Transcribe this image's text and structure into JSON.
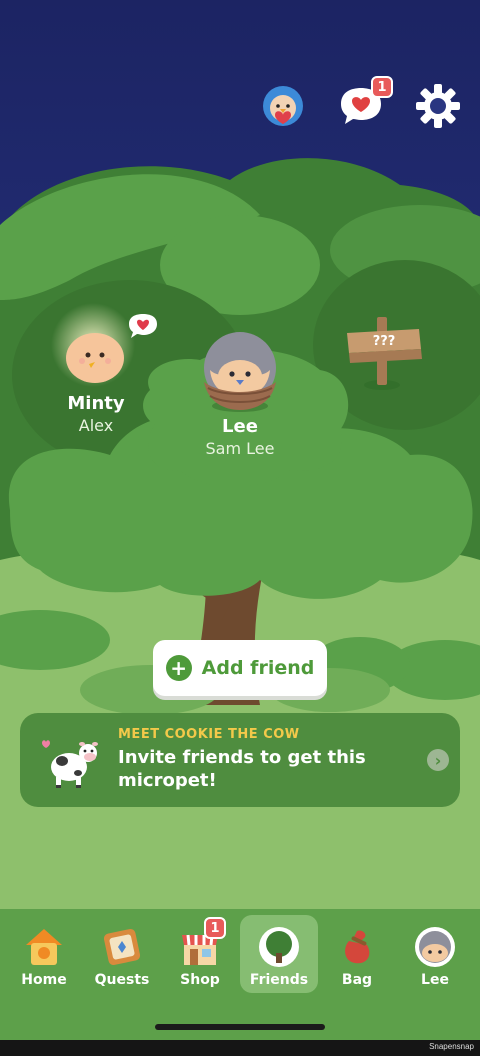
{
  "colors": {
    "sky_top": "#1d2565",
    "tree_dark": "#3f7f35",
    "tree_mid": "#5aa14a",
    "grass": "#8ec06c",
    "accent_green": "#4e9a3a",
    "promo_kicker": "#f3c94a",
    "badge_red": "#e85a5a"
  },
  "top_bar": {
    "icons": [
      "bird-hug-icon",
      "heart-message-icon",
      "gear-icon"
    ],
    "messages_badge": "1"
  },
  "pets": [
    {
      "pet_name": "Minty",
      "owner": "Alex",
      "has_heart_bubble": true
    },
    {
      "pet_name": "Lee",
      "owner": "Sam Lee",
      "in_nest": true
    }
  ],
  "signpost": {
    "text": "???"
  },
  "add_friend": {
    "label": "Add friend",
    "icon": "plus-icon"
  },
  "promo": {
    "kicker": "MEET COOKIE THE COW",
    "message": "Invite friends to get this micropet!",
    "icon": "cow-icon"
  },
  "nav": {
    "items": [
      {
        "label": "Home",
        "icon": "birdhouse-icon",
        "active": false
      },
      {
        "label": "Quests",
        "icon": "quest-board-icon",
        "active": false
      },
      {
        "label": "Shop",
        "icon": "shop-icon",
        "active": false,
        "badge": "1"
      },
      {
        "label": "Friends",
        "icon": "tree-icon",
        "active": true
      },
      {
        "label": "Bag",
        "icon": "bag-icon",
        "active": false
      },
      {
        "label": "Lee",
        "icon": "avatar-icon",
        "active": false
      }
    ]
  },
  "watermark": "Snapensnap"
}
